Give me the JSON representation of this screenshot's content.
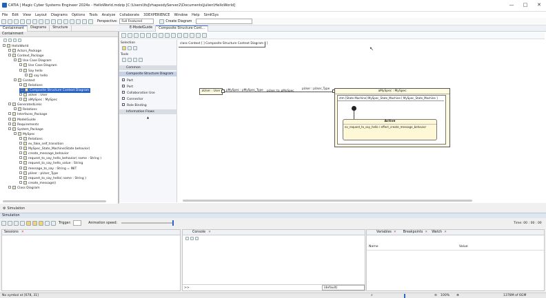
{
  "window": {
    "title": "CATIA | Magic Cyber Systems Engineer 2024x - HelloWorld.mdzip [C:\\Users\\ItsJ\\rhapsodyServer2\\Documents\\Julien\\HelloWorld]",
    "minimize": "—",
    "maximize": "□",
    "close": "✕"
  },
  "menu": [
    "File",
    "Edit",
    "View",
    "Layout",
    "Diagrams",
    "Options",
    "Tools",
    "Analyze",
    "Collaborate",
    "3DEXPERIENCE",
    "Window",
    "Help",
    "SimKSys"
  ],
  "toolbar": {
    "perspective_label": "Perspective:",
    "perspective_value": "Full Featured",
    "create_diagram": "Create Diagram"
  },
  "left_tabs": [
    "Containment",
    "Diagrams",
    "Structure"
  ],
  "containment": {
    "title": "Containment",
    "tree": [
      {
        "label": "HelloWorld",
        "indent": 0
      },
      {
        "label": "Actors_Package",
        "indent": 1
      },
      {
        "label": "Context_Package",
        "indent": 1
      },
      {
        "label": "Use Case Diagram",
        "indent": 2
      },
      {
        "label": "Use Case Diagram",
        "indent": 3
      },
      {
        "label": "Say hello",
        "indent": 3
      },
      {
        "label": "say hello",
        "indent": 4
      },
      {
        "label": "Context",
        "indent": 2
      },
      {
        "label": "Relations",
        "indent": 3
      },
      {
        "label": "Composite Structure Context Diagram",
        "indent": 3,
        "selected": true
      },
      {
        "label": "aUser : User",
        "indent": 3
      },
      {
        "label": "aMySpec : MySpec",
        "indent": 3
      },
      {
        "label": "GeneratedLinks",
        "indent": 1
      },
      {
        "label": "Relations",
        "indent": 2
      },
      {
        "label": "Interfaces_Package",
        "indent": 1
      },
      {
        "label": "ModelGuide",
        "indent": 1
      },
      {
        "label": "Requirements",
        "indent": 1
      },
      {
        "label": "System_Package",
        "indent": 1
      },
      {
        "label": "MySpec",
        "indent": 2
      },
      {
        "label": "Relations",
        "indent": 3
      },
      {
        "label": "ev_fake_self_transition",
        "indent": 3
      },
      {
        "label": "MySpec_State_Machine(State behavior)",
        "indent": 3
      },
      {
        "label": "create_message_behavior",
        "indent": 3
      },
      {
        "label": "request_to_say_hello_behavior( name : String )",
        "indent": 3
      },
      {
        "label": "request_to_say_hello_value : String",
        "indent": 3
      },
      {
        "label": "message_to_say : String = INIT",
        "indent": 3
      },
      {
        "label": "pUser : pUser_Type",
        "indent": 3
      },
      {
        "label": "request_to_say_hello( name : String )",
        "indent": 3
      },
      {
        "label": "create_message()",
        "indent": 3
      },
      {
        "label": "Class Diagram",
        "indent": 1
      }
    ]
  },
  "editor_tabs": [
    "E-ModelGuide",
    "Composite Structure Cont..."
  ],
  "palette": {
    "selection": "Selection",
    "tools": "Tools",
    "sections": [
      "Common",
      "Composite Structure Diagram"
    ],
    "items": [
      "Part",
      "Port",
      "Collaboration Use",
      "Connector",
      "Role Binding"
    ],
    "flows": "Information Flows"
  },
  "diagram": {
    "frame_label": "class   Context [  ]   Composite Structure Context Diagram  [ ]",
    "user_part": "aUser : User",
    "port_user": "pMySpec : pMySpec_Type",
    "connector": "pUser_to_pMySpec",
    "port_spec": "pUser : pUser_Type",
    "spec_part": "aMySpec : MySpec",
    "state_machine": "ctm [State Machine] MySpec_State_Machine [ MySpec_State_Machine ]",
    "state_name": "Active",
    "transition": "ev_request_to_say_hello / effect_create_message_behavior"
  },
  "simulation": {
    "tab": "Simulation",
    "panel_title": "Simulation",
    "trigger": "Trigger:",
    "animation_speed": "Animation speed:",
    "time": "Time: 00 : 00 : 00",
    "sessions": "Sessions",
    "console": "Console",
    "console_prompt": ">>",
    "console_default": "(default)",
    "variables": "Variables",
    "breakpoints": "Breakpoints",
    "watch": "Watch",
    "col_name": "Name",
    "col_value": "Value"
  },
  "status": {
    "left": "No symbol at [678, 31]",
    "zoom": "100%",
    "memory": "1378M of 6GM"
  }
}
